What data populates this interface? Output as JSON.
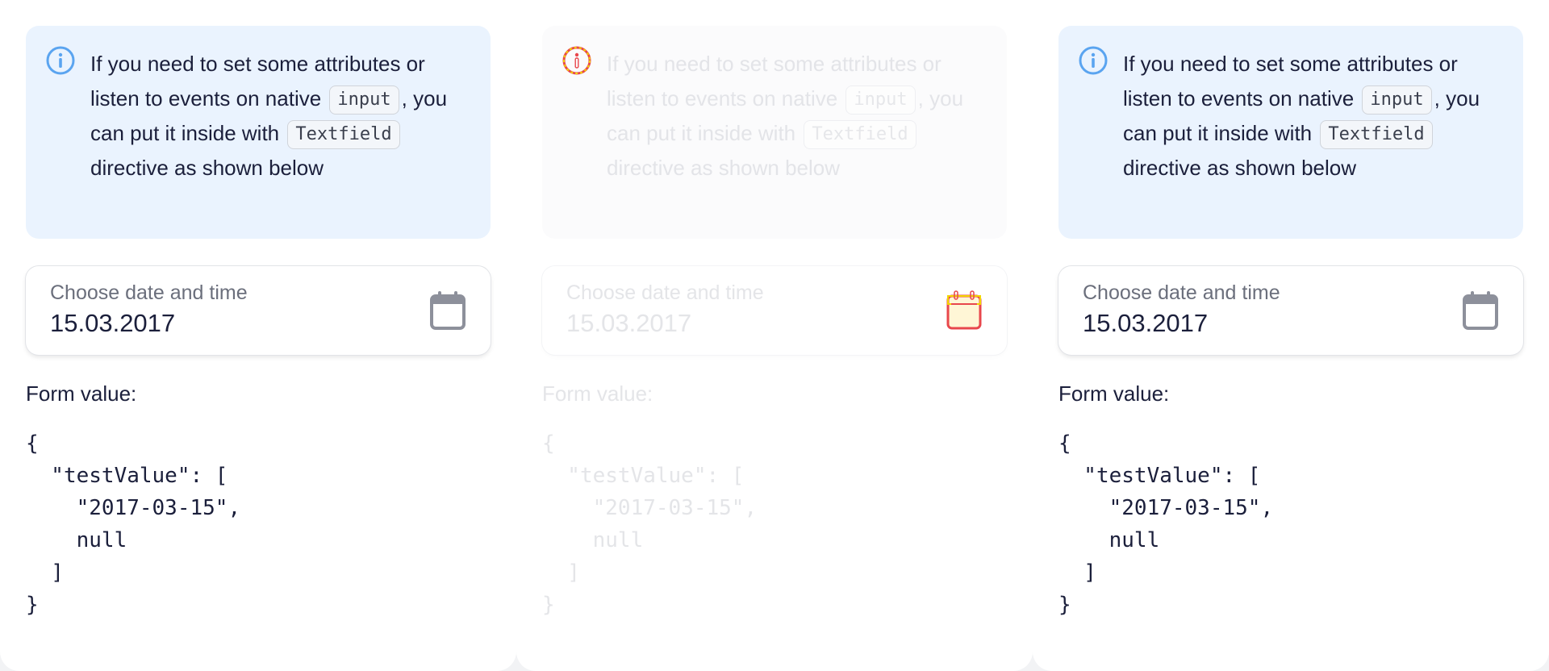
{
  "panels": [
    {
      "notice": {
        "text_1": "If you need to set some attributes or listen to events on native",
        "code_1": "input",
        "text_2": ", you can put it inside with",
        "code_2": "Textfield",
        "text_3": "directive as shown below"
      },
      "field": {
        "label": "Choose date and time",
        "value": "15.03.2017"
      },
      "form_label": "Form value:",
      "json": "{\n  \"testValue\": [\n    \"2017-03-15\",\n    null\n  ]\n}"
    },
    {
      "notice": {
        "text_1": "If you need to set some attributes or listen to events on native",
        "code_1": "input",
        "text_2": ", you can put it inside with",
        "code_2": "Textfield",
        "text_3": "directive as shown below"
      },
      "field": {
        "label": "Choose date and time",
        "value": "15.03.2017"
      },
      "form_label": "Form value:",
      "json": "{\n  \"testValue\": [\n    \"2017-03-15\",\n    null\n  ]\n}"
    },
    {
      "notice": {
        "text_1": "If you need to set some attributes or listen to events on native",
        "code_1": "input",
        "text_2": ", you can put it inside with",
        "code_2": "Textfield",
        "text_3": "directive as shown below"
      },
      "field": {
        "label": "Choose date and time",
        "value": "15.03.2017"
      },
      "form_label": "Form value:",
      "json": "{\n  \"testValue\": [\n    \"2017-03-15\",\n    null\n  ]\n}"
    }
  ],
  "icons": {
    "info": "info-circle-icon",
    "calendar": "calendar-icon"
  },
  "colors": {
    "notice_bg": "#eaf3fe",
    "info_icon": "#5aa4f0",
    "calendar_icon": "#8d909b",
    "text": "#1b1f3b",
    "diff_highlight_red": "#e8474c",
    "diff_highlight_yellow": "#f2d400"
  }
}
